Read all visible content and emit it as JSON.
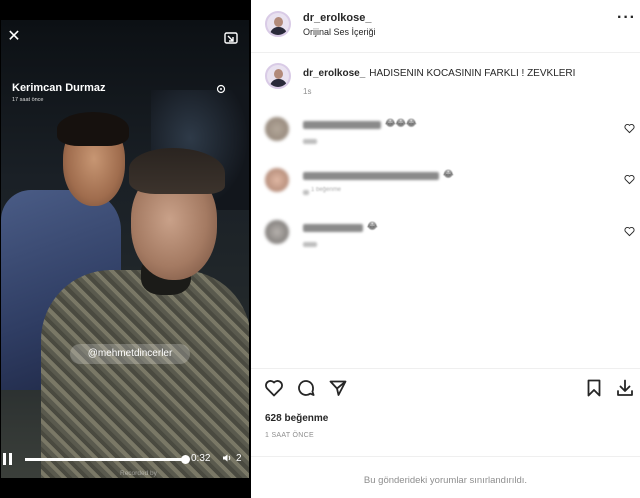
{
  "video": {
    "story_user": "Kerimcan Durmaz",
    "story_time": "17 saat önce",
    "mention": "@mehmetdincerler",
    "time": "0:32",
    "speed": "2",
    "progress": 0.98,
    "watermark": "Recorded by"
  },
  "header": {
    "username": "dr_erolkose_",
    "audio": "Orijinal Ses İçeriği"
  },
  "caption": {
    "username": "dr_erolkose_",
    "text": "HADISENIN KOCASININ FARKLI ! ZEVKLERI",
    "time": "1s"
  },
  "comments": [
    {
      "emoji": "😂😂😂",
      "meta": ""
    },
    {
      "emoji": "😂",
      "meta": "1 beğenme"
    },
    {
      "emoji": "😂",
      "meta": ""
    }
  ],
  "stats": {
    "likes": "628 beğenme",
    "date": "1 SAAT ÖNCE"
  },
  "footer": {
    "restricted": "Bu gönderideki yorumlar sınırlandırıldı."
  }
}
